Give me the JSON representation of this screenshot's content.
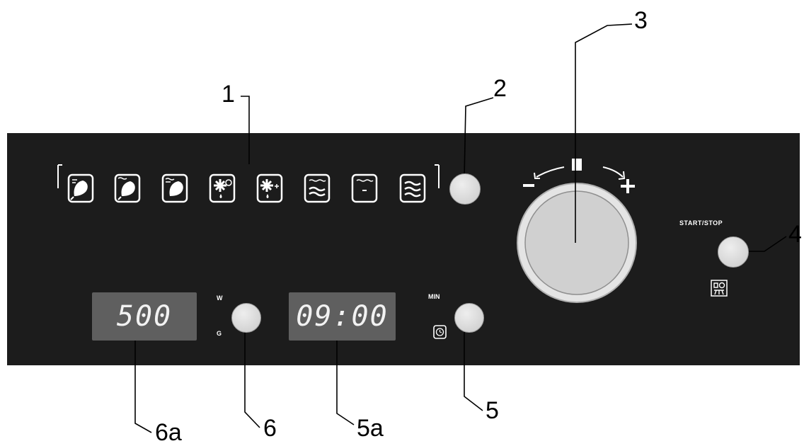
{
  "callouts": {
    "c1": "1",
    "c2": "2",
    "c3": "3",
    "c4": "4",
    "c5": "5",
    "c6": "6",
    "c5a": "5a",
    "c6a": "6a"
  },
  "panel": {
    "background": "#1c1c1c",
    "start_stop_label": "START/STOP",
    "power_unit_top": "W",
    "power_unit_bottom": "G",
    "time_unit_label": "MIN"
  },
  "displays": {
    "power_value": "500",
    "time_value": "09:00"
  },
  "mode_icons": [
    "chicken-grill-icon",
    "chicken-grill-microwave-icon",
    "chicken-grill-combi-icon",
    "defrost-weight-icon",
    "defrost-time-icon",
    "microwave-grill-icon",
    "top-heat-icon",
    "microwave-icon"
  ],
  "icons": {
    "timer": "clock-icon",
    "quick_start": "quick-start-icon"
  }
}
